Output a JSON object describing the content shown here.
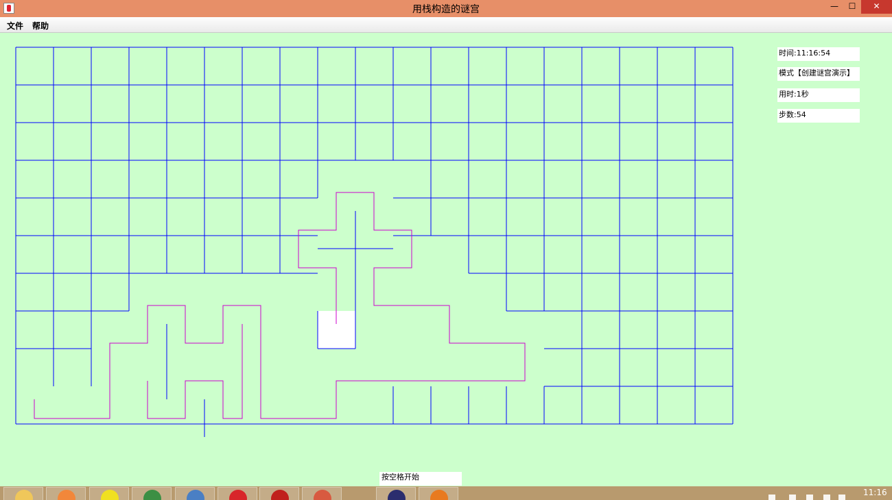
{
  "window": {
    "title": "用栈构造的谜宫",
    "minimize": "—",
    "maximize": "☐",
    "close": "✕"
  },
  "menu": {
    "file": "文件",
    "help": "帮助"
  },
  "info": {
    "time": "时间:11:16:54",
    "mode": "模式【创建谜宫演示】",
    "elapsed": "用时:1秒",
    "steps": "步数:54"
  },
  "start_hint": "按空格开始",
  "maze": {
    "rows": 10,
    "cols": 19,
    "wall_color": "#0000ff",
    "path_color": "#cc00cc",
    "current_cell_color": "#ffffff",
    "current_cell": [
      7,
      8
    ]
  },
  "taskbar": {
    "apps": [
      {
        "name": "file-explorer-icon",
        "color": "#f0c75a"
      },
      {
        "name": "media-app-icon",
        "color": "#f2873a"
      },
      {
        "name": "player-icon",
        "color": "#f0e020"
      },
      {
        "name": "chrome-icon",
        "color": "#3c8f44"
      },
      {
        "name": "tasks-icon",
        "color": "#4a7fc4"
      },
      {
        "name": "netease-music-icon",
        "color": "#d8262a"
      },
      {
        "name": "pdf-reader-icon",
        "color": "#c0201c"
      },
      {
        "name": "notes-icon",
        "color": "#d85a40"
      },
      {
        "name": "eclipse-icon",
        "color": "#2b2d6e"
      },
      {
        "name": "java-app-icon",
        "color": "#e87a20"
      }
    ],
    "clock": "11:16"
  }
}
